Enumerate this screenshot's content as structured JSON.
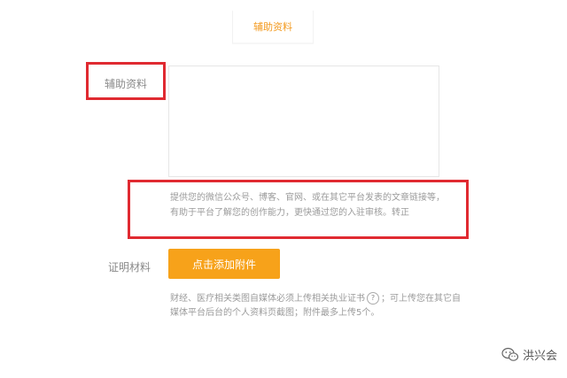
{
  "section": {
    "tab_label": "辅助资料"
  },
  "aux_field": {
    "label": "辅助资料",
    "value": "",
    "hint": "提供您的微信公众号、博客、官网、或在其它平台发表的文章链接等，有助于平台了解您的创作能力，更快通过您的入驻审核。转正"
  },
  "proof_field": {
    "label": "证明材料",
    "upload_label": "点击添加附件",
    "note_before": "财经、医疗相关类图自媒体必须上传相关执业证书",
    "help_glyph": "?",
    "note_after": "；可上传您在其它自媒体平台后台的个人资料页截图；附件最多上传5个。"
  },
  "watermark": {
    "text": "洪兴会",
    "icon": "wechat-icon"
  },
  "colors": {
    "accent": "#f7a21a",
    "highlight_border": "#e02a31",
    "tab_text": "#f39a1f"
  }
}
